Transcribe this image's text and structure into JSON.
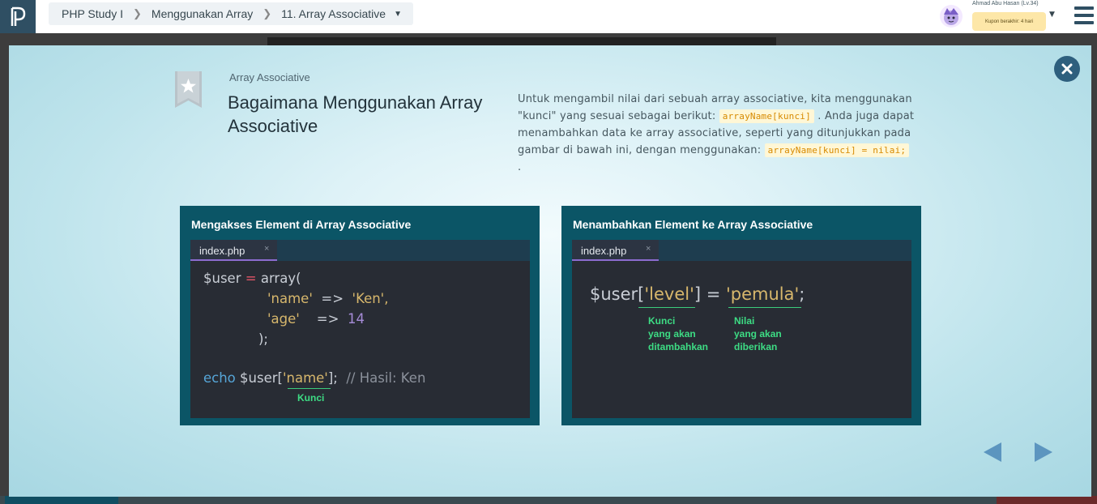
{
  "header": {
    "breadcrumb": [
      {
        "label": "PHP Study I"
      },
      {
        "label": "Menggunakan Array"
      },
      {
        "label": "11. Array Associative"
      }
    ],
    "username": "Ahmad Abu Hasan (Lv.34)",
    "coupon": "Kupon berakhir: 4 hari"
  },
  "lesson": {
    "subtitle": "Array Associative",
    "title": "Bagaimana Menggunakan Array Associative",
    "desc_part1": "Untuk mengambil nilai dari sebuah array associative, kita menggunakan \"kunci\" yang sesuai sebagai berikut:",
    "desc_code1": "arrayName[kunci]",
    "desc_part2": ". Anda juga dapat menambahkan data ke array associative, seperti yang ditunjukkan pada gambar di bawah ini, dengan menggunakan:",
    "desc_code2": "arrayName[kunci] = nilai;",
    "desc_part3": "."
  },
  "cards": [
    {
      "title": "Mengakses Element di Array Associative",
      "tab": "index.php",
      "tab_close": "×",
      "code": {
        "l1_var": "$user",
        "l1_op": "=",
        "l1_fn": "array(",
        "l2_key": "'name'",
        "l2_arrow": "=>",
        "l2_val": "'Ken',",
        "l3_key": "'age'",
        "l3_arrow": "=>",
        "l3_val": "14",
        "l4": ");",
        "l5_kw": "echo",
        "l5_var": "$user[",
        "l5_key": "'name'",
        "l5_end": "];",
        "l5_comment": "// Hasil: Ken"
      },
      "annotation": "Kunci"
    },
    {
      "title": "Menambahkan Element ke Array Associative",
      "tab": "index.php",
      "tab_close": "×",
      "code": {
        "var": "$user[",
        "key": "'level'",
        "mid": "] = ",
        "val": "'pemula'",
        "end": ";"
      },
      "annotation_key": [
        "Kunci",
        "yang akan",
        "ditambahkan"
      ],
      "annotation_val": [
        "Nilai",
        "yang akan",
        "diberikan"
      ]
    }
  ],
  "icons": {
    "logo": "progate-logo-icon",
    "close": "close-icon",
    "bookmark": "bookmark-star-icon",
    "prev": "prev-arrow-icon",
    "next": "next-arrow-icon",
    "menu": "hamburger-menu-icon"
  },
  "colors": {
    "header_dark": "#2f4f63",
    "card_teal": "#0b5566",
    "annotation_green": "#3ddc84",
    "nav_arrow": "#5c95bf"
  }
}
